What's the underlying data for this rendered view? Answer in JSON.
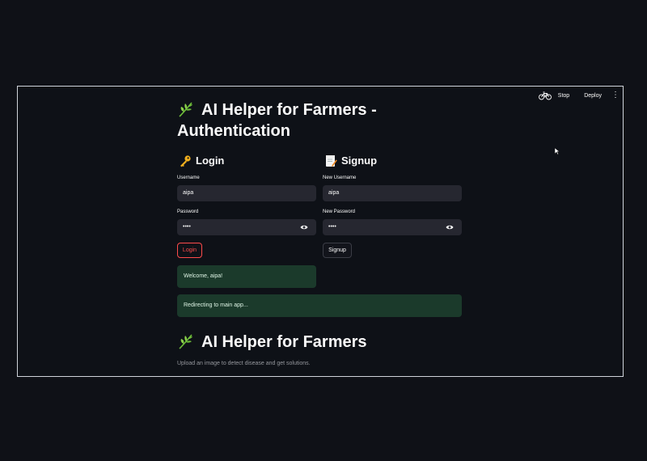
{
  "toolbar": {
    "running_icon": "bicycle-icon",
    "stop_label": "Stop",
    "deploy_label": "Deploy",
    "menu_icon": "kebab-menu-icon"
  },
  "auth": {
    "title_line1": "AI Helper for Farmers -",
    "title_line2": "Authentication",
    "title_icon": "herb-leaf-icon",
    "login": {
      "heading": "Login",
      "heading_icon": "key-icon",
      "username_label": "Username",
      "username_value": "aipa",
      "password_label": "Password",
      "password_value": "••••",
      "password_toggle_icon": "eye-icon",
      "button_label": "Login"
    },
    "signup": {
      "heading": "Signup",
      "heading_icon": "memo-icon",
      "username_label": "New Username",
      "username_value": "aipa",
      "password_label": "New Password",
      "password_value": "••••",
      "password_toggle_icon": "eye-icon",
      "button_label": "Signup"
    },
    "welcome_message": "Welcome, aipa!",
    "redirect_message": "Redirecting to main app..."
  },
  "app": {
    "title": "AI Helper for Farmers",
    "title_icon": "herb-leaf-icon",
    "caption": "Upload an image to detect disease and get solutions."
  },
  "colors": {
    "background": "#0e1117",
    "input_bg": "#262730",
    "primary": "#ff4b4b",
    "success_bg": "#1b3a2b",
    "frame_border": "#cfd3da"
  }
}
